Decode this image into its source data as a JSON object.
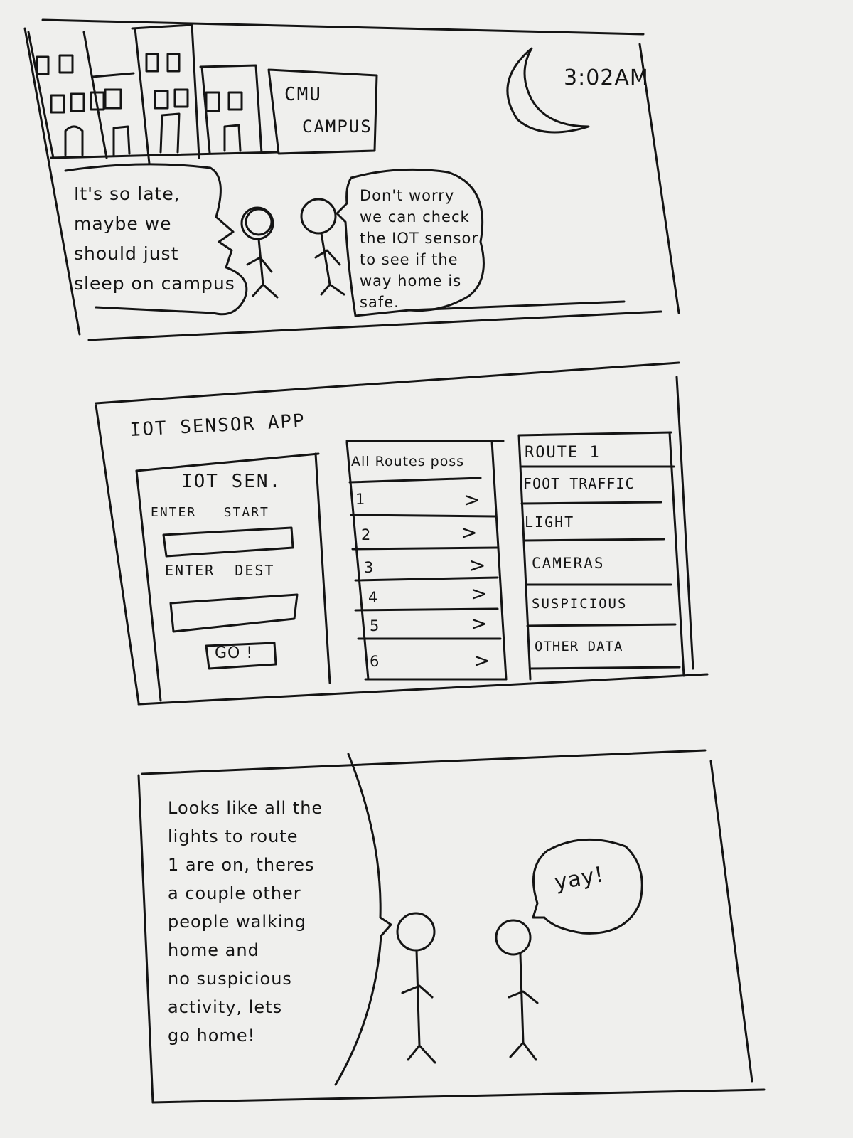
{
  "panel1": {
    "sign": [
      "CMU",
      "CAMPUS"
    ],
    "time": "3:02AM",
    "speech_left": "It's so late,\nmaybe we\nshould just\nsleep on campus",
    "speech_right": "Don't worry\nwe can check\nthe IOT sensor\nto see if the\nway home is\nsafe."
  },
  "panel2": {
    "app_title": "IOT SENSOR APP",
    "form": {
      "heading": "IOT SEN.",
      "start_label": "ENTER   START",
      "start_value": "",
      "dest_label": "ENTER  DEST",
      "dest_value": "",
      "go_label": "GO !"
    },
    "routes": {
      "header": "All Routes poss",
      "items": [
        {
          "num": "1",
          "arrow": ">"
        },
        {
          "num": "2",
          "arrow": ">"
        },
        {
          "num": "3",
          "arrow": ">"
        },
        {
          "num": "4",
          "arrow": ">"
        },
        {
          "num": "5",
          "arrow": ">"
        },
        {
          "num": "6",
          "arrow": ">"
        }
      ]
    },
    "details": {
      "header": "ROUTE 1",
      "items": [
        "FOOT TRAFFIC",
        "LIGHT",
        "CAMERAS",
        "SUSPICIOUS",
        "OTHER DATA"
      ]
    }
  },
  "panel3": {
    "narration": "Looks like all the\nlights to route\n1 are on, theres\na couple other\npeople walking\nhome and\nno suspicious\nactivity, lets\ngo home!",
    "speech": "yay!"
  }
}
